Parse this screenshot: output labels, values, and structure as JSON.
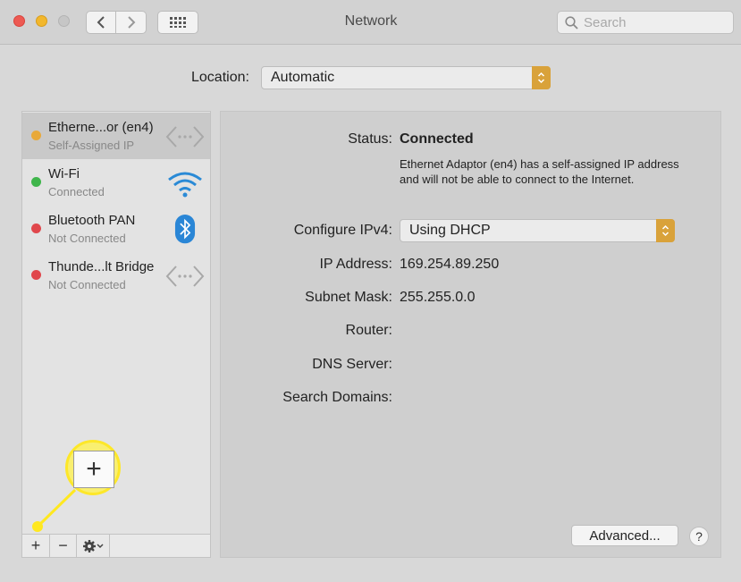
{
  "window": {
    "title": "Network",
    "search_placeholder": "Search"
  },
  "location": {
    "label": "Location:",
    "value": "Automatic"
  },
  "services": [
    {
      "name": "Etherne...or (en4)",
      "status": "Self-Assigned IP",
      "dot_color": "#e8a93a",
      "icon": "ethernet-arrows-icon",
      "selected": true
    },
    {
      "name": "Wi-Fi",
      "status": "Connected",
      "dot_color": "#3fb54b",
      "icon": "wifi-icon",
      "selected": false
    },
    {
      "name": "Bluetooth PAN",
      "status": "Not Connected",
      "dot_color": "#e0474c",
      "icon": "bluetooth-icon",
      "selected": false
    },
    {
      "name": "Thunde...lt Bridge",
      "status": "Not Connected",
      "dot_color": "#e0474c",
      "icon": "ethernet-arrows-icon",
      "selected": false
    }
  ],
  "toolbar": {
    "add": "+",
    "remove": "−"
  },
  "callout": {
    "symbol": "+",
    "color": "#ffe820"
  },
  "details": {
    "status_label": "Status:",
    "status_value": "Connected",
    "status_description": "Ethernet Adaptor (en4) has a self-assigned IP address and will not be able to connect to the Internet.",
    "configure_label": "Configure IPv4:",
    "configure_value": "Using DHCP",
    "ip_label": "IP Address:",
    "ip_value": "169.254.89.250",
    "subnet_label": "Subnet Mask:",
    "subnet_value": "255.255.0.0",
    "router_label": "Router:",
    "router_value": "",
    "dns_label": "DNS Server:",
    "dns_value": "",
    "search_domains_label": "Search Domains:",
    "search_domains_value": ""
  },
  "buttons": {
    "advanced": "Advanced...",
    "help": "?"
  },
  "colors": {
    "accent_popup": "#d9a23a",
    "selected_row": "#c9c9c9"
  }
}
